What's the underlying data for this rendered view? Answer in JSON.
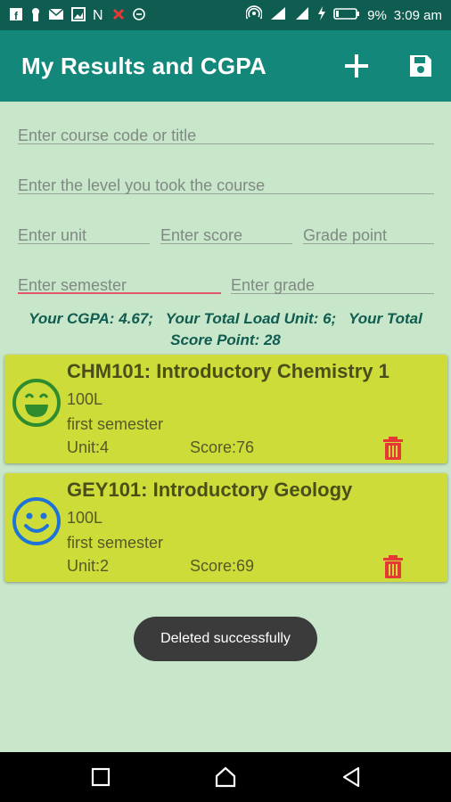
{
  "status_bar": {
    "left_icons": [
      "facebook-icon",
      "keyhole-icon",
      "mail-icon",
      "image-icon",
      "n-icon",
      "close-x-icon",
      "minus-circle-icon"
    ],
    "battery": "9%",
    "time": "3:09 am"
  },
  "app_bar": {
    "title": "My Results and CGPA",
    "add_icon": "plus-icon",
    "save_icon": "save-icon",
    "color": "#13877a"
  },
  "form": {
    "course_placeholder": "Enter course code or title",
    "level_placeholder": "Enter the level you took the course",
    "unit_placeholder": "Enter unit",
    "score_placeholder": "Enter score",
    "grade_point_placeholder": "Grade point",
    "semester_placeholder": "Enter semester",
    "grade_placeholder": "Enter grade"
  },
  "summary": {
    "line1": "Your CGPA: 4.67;   Your Total Load Unit: 6;   Your Total",
    "line2": "Score Point: 28"
  },
  "courses": [
    {
      "title": "CHM101: Introductory Chemistry 1",
      "level": "100L",
      "semester": "first semester",
      "unit": "Unit:4",
      "score": "Score:76",
      "face_icon": "grin-face-icon",
      "face_color": "#2e8b2e"
    },
    {
      "title": "GEY101: Introductory Geology",
      "level": "100L",
      "semester": "first semester",
      "unit": "Unit:2",
      "score": "Score:69",
      "face_icon": "smile-face-icon",
      "face_color": "#1e73d8"
    }
  ],
  "toast": {
    "message": "Deleted successfully"
  },
  "nav_bar": {
    "buttons": [
      "recents-icon",
      "home-icon",
      "back-icon"
    ]
  }
}
